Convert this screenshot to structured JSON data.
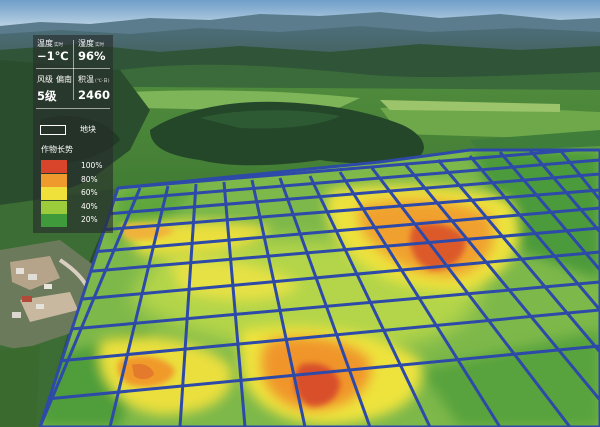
{
  "stats": {
    "temperature": {
      "label": "温度",
      "sub": "实时",
      "value": "−1℃"
    },
    "humidity": {
      "label": "湿度",
      "sub": "实时",
      "value": "96%"
    },
    "wind": {
      "label": "风级",
      "direction": "偏南",
      "value": "5级"
    },
    "accumulated_temp": {
      "label": "积温",
      "sub": "(℃·日)",
      "value": "2460"
    }
  },
  "plot_legend": {
    "label": "地块"
  },
  "growth_legend": {
    "title": "作物长势",
    "items": [
      {
        "label": "100%",
        "color": "#d8452a"
      },
      {
        "label": "80%",
        "color": "#ef9a2c"
      },
      {
        "label": "60%",
        "color": "#efe03a"
      },
      {
        "label": "40%",
        "color": "#9ccb3c"
      },
      {
        "label": "20%",
        "color": "#3e9a3a"
      }
    ]
  },
  "colors": {
    "grid": "#2e4aa8",
    "panel": "#282c2c"
  }
}
